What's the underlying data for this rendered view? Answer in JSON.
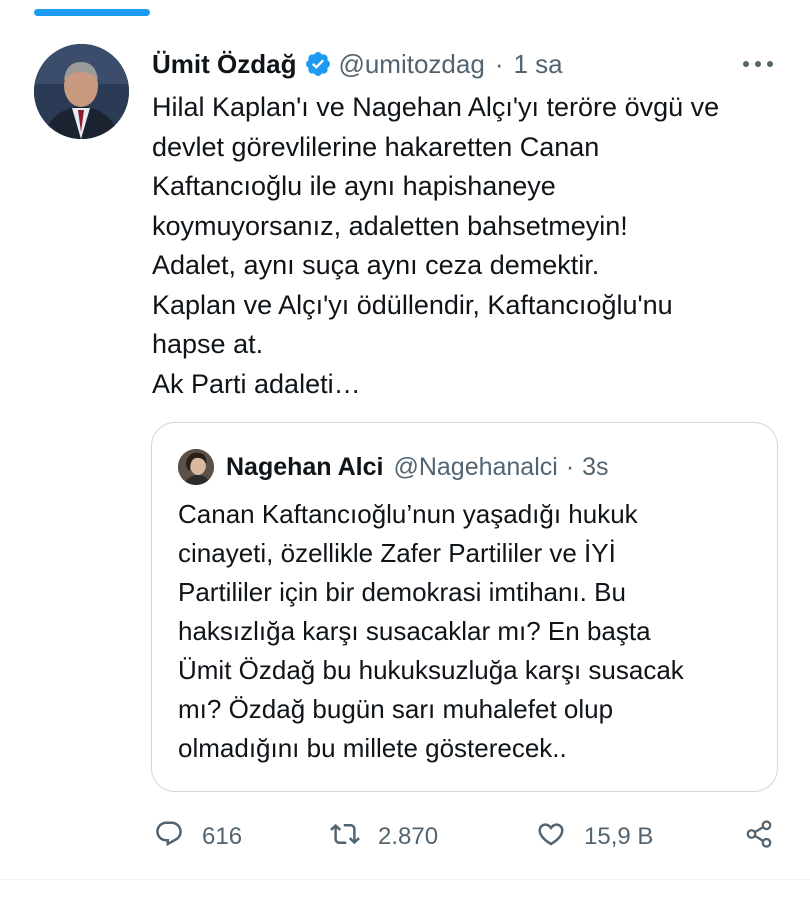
{
  "author": {
    "name": "Ümit Özdağ",
    "handle": "@umitozdag",
    "separator": "·",
    "time": "1 sa",
    "verified": true
  },
  "tweet": {
    "lines": [
      "Hilal Kaplan'ı ve Nagehan Alçı'yı teröre övgü ve",
      "devlet görevlilerine hakaretten Canan",
      "Kaftancıoğlu ile aynı hapishaneye",
      "koymuyorsanız, adaletten bahsetmeyin!",
      "Adalet, aynı suça aynı ceza demektir.",
      "Kaplan ve Alçı'yı ödüllendir, Kaftancıoğlu'nu",
      "hapse at.",
      "Ak Parti adaleti…"
    ]
  },
  "quote": {
    "name": "Nagehan Alci",
    "handle": "@Nagehanalci",
    "separator": "·",
    "time": "3s",
    "lines": [
      "Canan Kaftancıoğlu’nun yaşadığı hukuk",
      "cinayeti, özellikle Zafer Partililer ve İYİ",
      "Partililer için bir demokrasi imtihanı. Bu",
      "haksızlığa karşı susacaklar mı? En başta",
      "Ümit Özdağ bu hukuksuzluğa karşı susacak",
      "mı? Özdağ bugün sarı muhalefet olup",
      "olmadığını bu millete gösterecek.."
    ]
  },
  "actions": {
    "reply_count": "616",
    "retweet_count": "2.870",
    "like_count": "15,9 B",
    "icons": [
      "reply-icon",
      "retweet-icon",
      "like-icon",
      "share-icon"
    ]
  },
  "colors": {
    "accent": "#1d9bf0",
    "text_primary": "#0f1419",
    "text_secondary": "#536471",
    "border": "#cfd9de"
  }
}
